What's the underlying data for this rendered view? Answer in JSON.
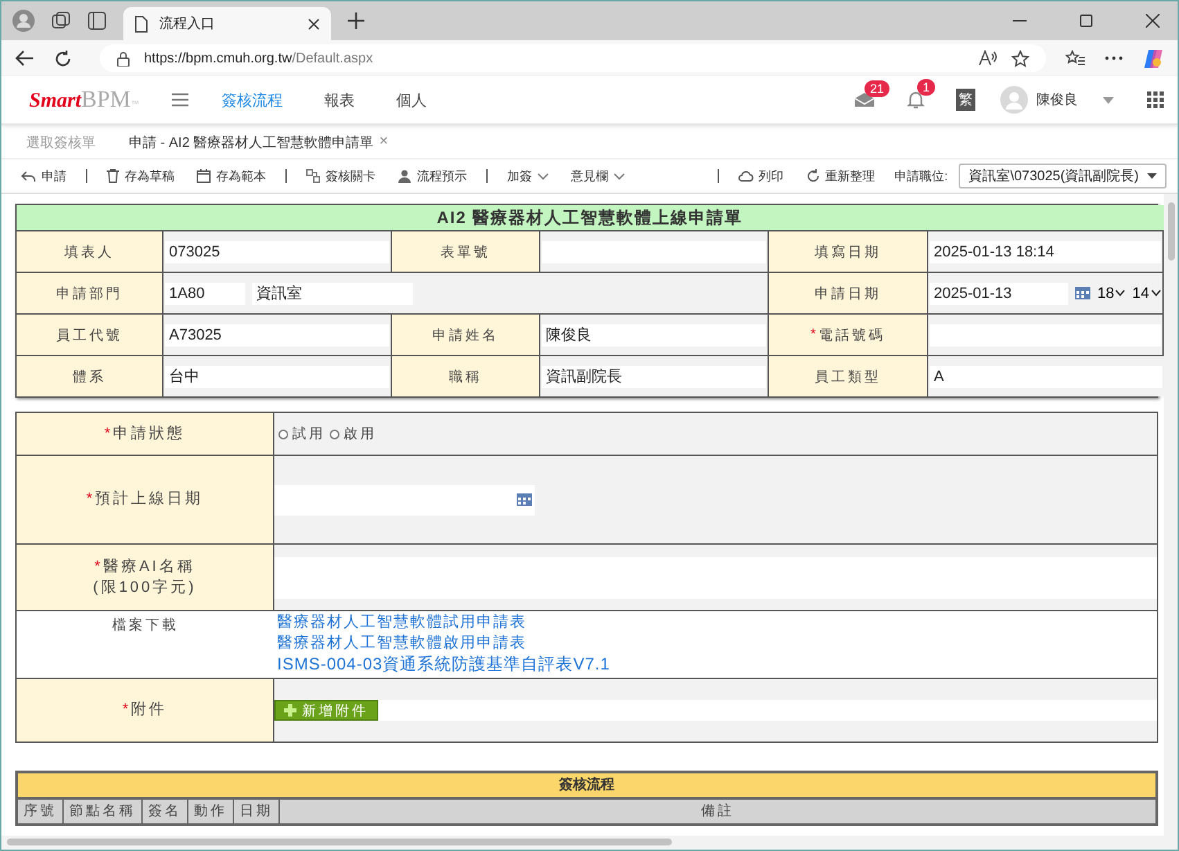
{
  "browser": {
    "tab_title": "流程入口",
    "url_host": "https://bpm.cmuh.org.tw",
    "url_path": "/Default.aspx"
  },
  "header": {
    "logo_a": "Smart",
    "logo_b": "BPM",
    "logo_tm": "™",
    "nav": [
      {
        "label": "簽核流程",
        "selected": true
      },
      {
        "label": "報表",
        "selected": false
      },
      {
        "label": "個人",
        "selected": false
      }
    ],
    "mail_count": "21",
    "alert_count": "1",
    "lang": "繁",
    "user": "陳俊良"
  },
  "doc_tabs": [
    {
      "label": "選取簽核單",
      "selected": false
    },
    {
      "label": "申請 - AI2 醫療器材人工智慧軟體申請單",
      "selected": true,
      "close": "×"
    }
  ],
  "toolbar": {
    "groups": [
      [
        {
          "kind": "reply",
          "label": "申請",
          "dropdown": false
        }
      ],
      [
        {
          "kind": "trash",
          "label": "存為草稿",
          "dropdown": false
        },
        {
          "kind": "calendar",
          "label": "存為範本",
          "dropdown": false
        }
      ],
      [
        {
          "kind": "stages",
          "label": "簽核關卡",
          "dropdown": false
        },
        {
          "kind": "person",
          "label": "流程預示",
          "dropdown": false
        }
      ],
      [
        {
          "kind": "none",
          "label": "加簽",
          "dropdown": true
        },
        {
          "kind": "none",
          "label": "意見欄",
          "dropdown": true
        }
      ]
    ],
    "right": [
      {
        "kind": "print",
        "label": "列印"
      },
      {
        "kind": "refresh",
        "label": "重新整理"
      }
    ],
    "position_label": "申請職位:",
    "position_value": "資訊室\\073025(資訊副院長)"
  },
  "form": {
    "title": "AI2 醫療器材人工智慧軟體上線申請單",
    "info_rows": [
      [
        {
          "kind": "label",
          "text": "填表人"
        },
        {
          "kind": "field",
          "value": "073025"
        },
        {
          "kind": "label",
          "text": "表單號"
        },
        {
          "kind": "field"
        },
        {
          "kind": "label",
          "text": "填寫日期"
        },
        {
          "kind": "field",
          "value": "2025-01-13 18:14"
        }
      ],
      [
        {
          "kind": "label",
          "text": "申請部門"
        },
        {
          "kind": "dept",
          "code": "1A80",
          "name": "資訊室"
        },
        {
          "kind": "label",
          "text": "申請日期"
        },
        {
          "kind": "date",
          "value": "2025-01-13",
          "hour": "18",
          "minute": "14"
        }
      ],
      [
        {
          "kind": "label",
          "text": "員工代號"
        },
        {
          "kind": "field",
          "value": "A73025"
        },
        {
          "kind": "label",
          "text": "申請姓名"
        },
        {
          "kind": "field",
          "value": "陳俊良"
        },
        {
          "kind": "label",
          "text": "電話號碼",
          "mark": "*"
        },
        {
          "kind": "field"
        }
      ],
      [
        {
          "kind": "label",
          "text": "體系"
        },
        {
          "kind": "field",
          "value": "台中"
        },
        {
          "kind": "label",
          "text": "職稱"
        },
        {
          "kind": "field",
          "value": "資訊副院長"
        },
        {
          "kind": "label",
          "text": "員工類型"
        },
        {
          "kind": "field",
          "value": "A"
        }
      ]
    ],
    "detail_rows": [
      {
        "kind": "radio",
        "label": "申請狀態",
        "mark": "*",
        "options": [
          {
            "label": "試用",
            "selected": false
          },
          {
            "label": "啟用",
            "selected": false
          }
        ]
      },
      {
        "kind": "date",
        "label": "預計上線日期",
        "mark": "*"
      },
      {
        "kind": "textarea",
        "label": "醫療AI名稱",
        "note": "(限100字元)",
        "mark": "*"
      },
      {
        "kind": "links",
        "label": "檔案下載",
        "links": [
          "醫療器材人工智慧軟體試用申請表",
          "醫療器材人工智慧軟體啟用申請表",
          "ISMS-004-03資通系統防護基準自評表V7.1"
        ]
      },
      {
        "kind": "upload",
        "label": "附件",
        "mark": "*",
        "button": "新增附件"
      }
    ]
  },
  "flow": {
    "title": "簽核流程",
    "columns": [
      "序號",
      "節點名稱",
      "簽名",
      "動作",
      "日期",
      "備註"
    ]
  }
}
